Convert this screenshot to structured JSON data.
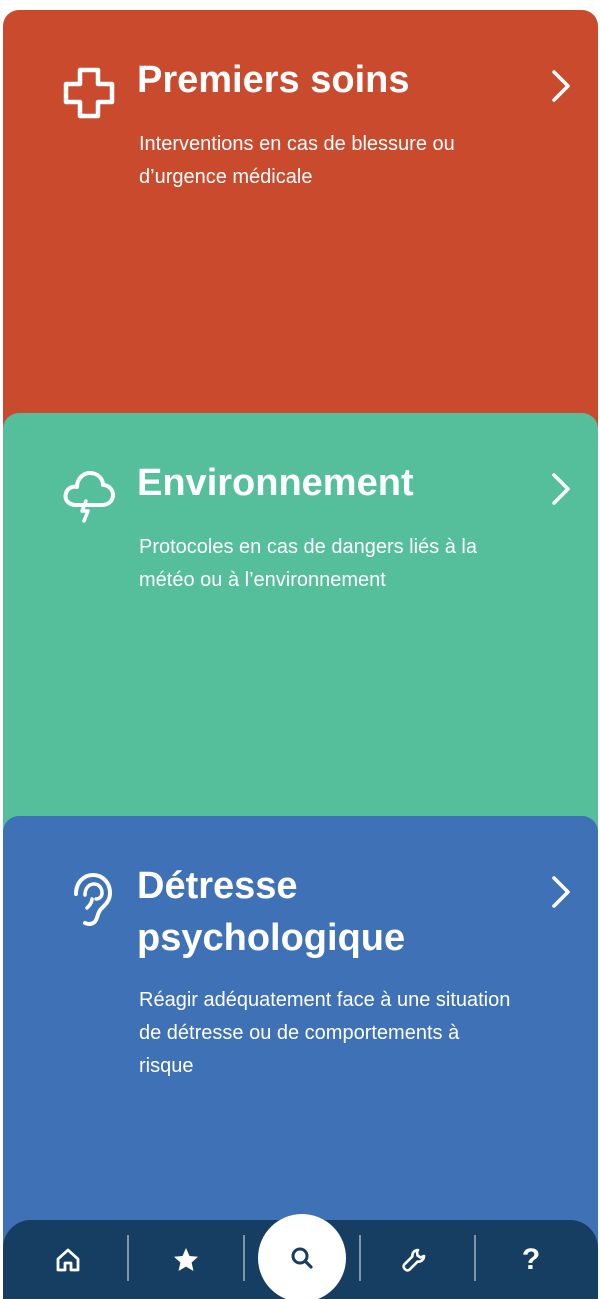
{
  "cards": [
    {
      "title": "Premiers soins",
      "description": "Interventions en cas de blessure ou d’urgence médicale",
      "icon": "medical-cross-icon",
      "color": "#ca4a2e"
    },
    {
      "title": "Environnement",
      "description": "Protocoles en cas de dangers liés à la météo ou à l’environnement",
      "icon": "storm-cloud-icon",
      "color": "#55bf9c"
    },
    {
      "title": "Détresse psychologique",
      "description": "Réagir adéquatement face à une situation de détresse ou de comportements à risque",
      "icon": "ear-icon",
      "color": "#3f71b6"
    }
  ],
  "bottom_nav": {
    "background": "#163e63",
    "items": [
      {
        "icon": "home-icon"
      },
      {
        "icon": "star-icon"
      },
      {
        "icon": "search-icon",
        "active": true
      },
      {
        "icon": "wrench-icon"
      },
      {
        "icon": "help-icon",
        "glyph": "?"
      }
    ]
  }
}
